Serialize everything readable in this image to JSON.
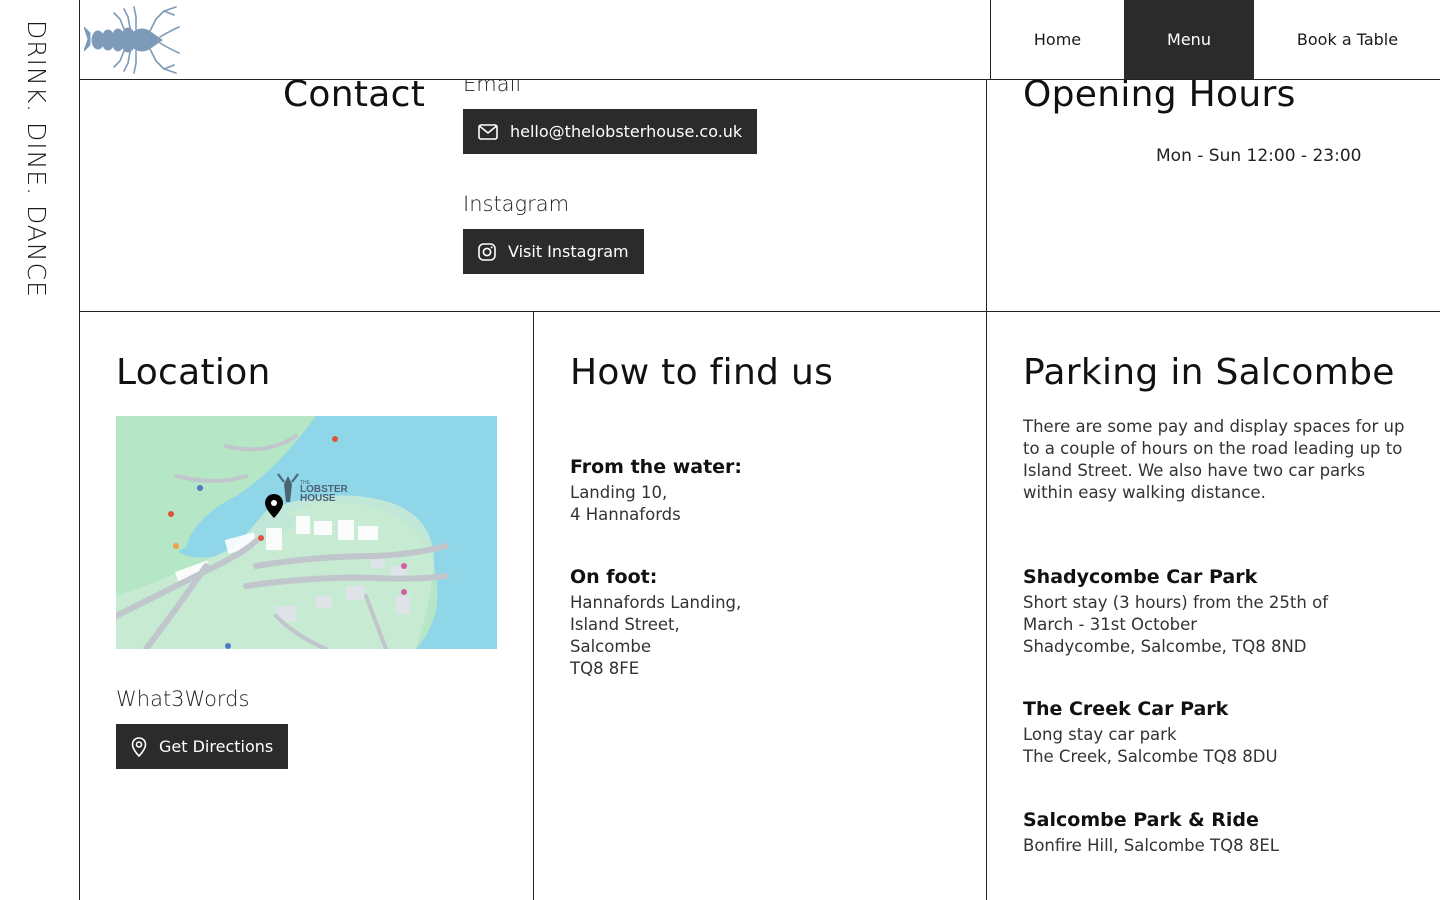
{
  "tagline": "DRINK. DINE. DANCE",
  "nav": {
    "home": "Home",
    "menu": "Menu",
    "book": "Book a Table"
  },
  "contact": {
    "title": "Contact",
    "email_label": "Email",
    "email_button": "hello@thelobsterhouse.co.uk",
    "instagram_label": "Instagram",
    "instagram_button": "Visit Instagram"
  },
  "opening_hours": {
    "title": "Opening Hours",
    "hours": "Mon - Sun 12:00 - 23:00"
  },
  "location": {
    "title": "Location",
    "map_logo_line1": "THE",
    "map_logo_line2": "LOBSTER",
    "map_logo_line3": "HOUSE",
    "what3words_label": "What3Words",
    "directions_button": "Get Directions"
  },
  "find_us": {
    "title": "How to find us",
    "water_title": "From the water:",
    "water_lines": [
      "Landing 10,",
      "4 Hannafords"
    ],
    "foot_title": "On foot:",
    "foot_lines": [
      "Hannafords Landing,",
      "Island Street,",
      "Salcombe",
      "TQ8 8FE"
    ]
  },
  "parking": {
    "title": "Parking in Salcombe",
    "intro": "There are some pay and display spaces for up to a couple of hours on the road leading up to Island Street. We also have two car parks within easy walking distance.",
    "car_parks": [
      {
        "name": "Shadycombe Car Park",
        "lines": [
          "Short stay (3 hours) from the 25th of",
          "March - 31st October",
          "Shadycombe, Salcombe, TQ8 8ND"
        ]
      },
      {
        "name": "The Creek Car Park",
        "lines": [
          "Long stay car park",
          "The Creek, Salcombe TQ8 8DU"
        ]
      },
      {
        "name": "Salcombe Park & Ride",
        "lines": [
          "Bonfire Hill, Salcombe TQ8 8EL"
        ]
      }
    ]
  },
  "colors": {
    "dark": "#2b2b2b",
    "water": "#8fd6e8",
    "land": "#aee3c2",
    "logo": "#7d9bb8"
  },
  "icons": [
    "lobster-logo",
    "mail-icon",
    "instagram-icon",
    "location-pin-icon",
    "map-marker-icon"
  ]
}
